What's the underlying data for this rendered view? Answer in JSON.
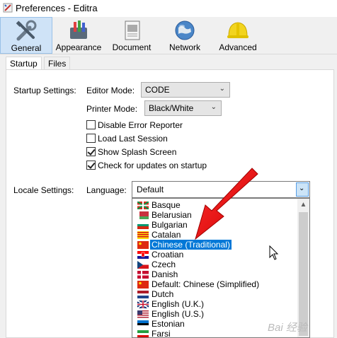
{
  "window": {
    "title": "Preferences - Editra"
  },
  "toolbar": {
    "items": [
      {
        "label": "General",
        "icon": "tools-icon"
      },
      {
        "label": "Appearance",
        "icon": "appearance-icon"
      },
      {
        "label": "Document",
        "icon": "document-icon"
      },
      {
        "label": "Network",
        "icon": "globe-icon"
      },
      {
        "label": "Advanced",
        "icon": "hardhat-icon"
      }
    ]
  },
  "tabs": [
    "Startup",
    "Files"
  ],
  "startup": {
    "startup_settings_label": "Startup Settings:",
    "editor_mode_label": "Editor Mode:",
    "editor_mode_value": "CODE",
    "printer_mode_label": "Printer Mode:",
    "printer_mode_value": "Black/White",
    "checkboxes": [
      {
        "label": "Disable Error Reporter",
        "checked": false
      },
      {
        "label": "Load Last Session",
        "checked": false
      },
      {
        "label": "Show Splash Screen",
        "checked": true
      },
      {
        "label": "Check for updates on startup",
        "checked": true
      }
    ]
  },
  "locale": {
    "locale_settings_label": "Locale Settings:",
    "language_label": "Language:",
    "language_value": "Default",
    "options": [
      "Basque",
      "Belarusian",
      "Bulgarian",
      "Catalan",
      "Chinese (Traditional)",
      "Croatian",
      "Czech",
      "Danish",
      "Default: Chinese (Simplified)",
      "Dutch",
      "English (U.K.)",
      "English (U.S.)",
      "Estonian",
      "Farsi"
    ],
    "selected_option": "Chinese (Traditional)"
  },
  "watermark": "Bai 经验"
}
